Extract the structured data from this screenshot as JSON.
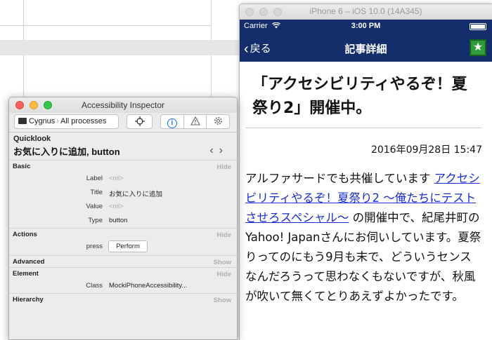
{
  "simulator": {
    "window_title": "iPhone 6 – iOS 10.0 (14A345)",
    "status": {
      "carrier": "Carrier",
      "time": "3:00 PM"
    },
    "nav": {
      "back_label": "戻る",
      "title": "記事詳細",
      "star_glyph": "★"
    },
    "article": {
      "title": "「アクセシビリティやるぞ！夏祭り2」開催中。",
      "date": "2016年09月28日 15:47",
      "body_before": "アルファサードでも共催しています ",
      "link_text": "アクセシビリティやるぞ！夏祭り2 〜俺たちにテストさせろスペシャル〜",
      "body_after": " の開催中で、紀尾井町の Yahoo! Japanさんにお伺いしています。夏祭りってのにもう9月も末で、どういうセンスなんだろうって思わなくもないですが、秋風が吹いて無くてとりあえずよかったです。"
    }
  },
  "inspector": {
    "window_title": "Accessibility Inspector",
    "target": {
      "device": "Cygnus",
      "scope": "All processes"
    },
    "quicklook": {
      "label": "Quicklook",
      "value": "お気に入りに追加, button"
    },
    "sections": {
      "basic": {
        "title": "Basic",
        "toggle": "Hide",
        "label_key": "Label",
        "label_value": "<nil>",
        "title_key": "Title",
        "title_value": "お気に入りに追加",
        "value_key": "Value",
        "value_value": "<nil>",
        "type_key": "Type",
        "type_value": "button"
      },
      "actions": {
        "title": "Actions",
        "toggle": "Hide",
        "press_key": "press",
        "perform_label": "Perform"
      },
      "advanced": {
        "title": "Advanced",
        "toggle": "Show"
      },
      "element": {
        "title": "Element",
        "toggle": "Hide",
        "class_key": "Class",
        "class_value": "MockiPhoneAccessibility..."
      },
      "hierarchy": {
        "title": "Hierarchy",
        "toggle": "Show"
      }
    }
  },
  "colors": {
    "ios_bar": "#142e6b",
    "link": "#1a2cd6",
    "star_green": "#2e9c3a",
    "close_red": "#fc605c",
    "min_yellow": "#fdbc40",
    "zoom_green": "#34c84a"
  },
  "icons": [
    "wifi-icon",
    "battery-icon",
    "chevron-left-icon",
    "star-icon",
    "desktop-icon",
    "crosshair-icon",
    "info-icon",
    "warning-icon",
    "gear-icon",
    "chevron-left-icon",
    "chevron-right-icon"
  ]
}
